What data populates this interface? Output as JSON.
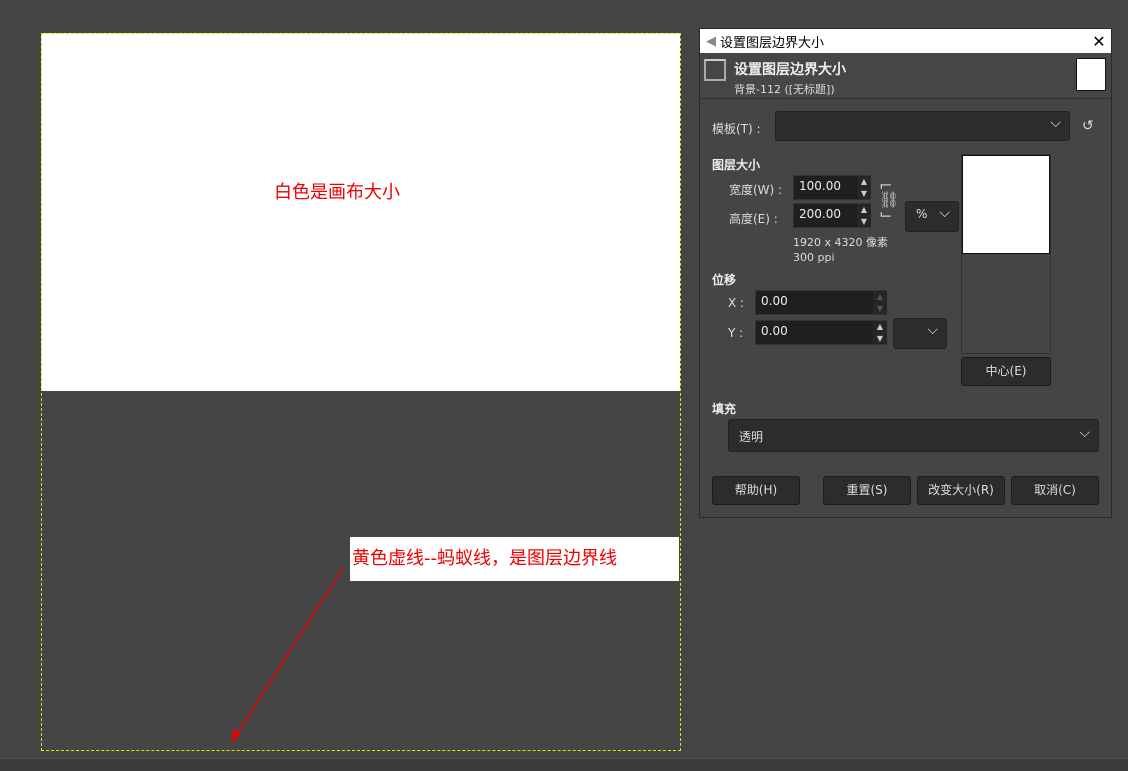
{
  "canvas": {
    "annotation_canvas": "白色是画布大小",
    "annotation_border": "黄色虚线--蚂蚁线，是图层边界线"
  },
  "dialog": {
    "window_title": "设置图层边界大小",
    "close_label": "✕",
    "header_title": "设置图层边界大小",
    "header_subtitle": "背景-112 ([无标题])",
    "template_label": "模板(T) :",
    "template_value": "",
    "layer_size_label": "图层大小",
    "width_label": "宽度(W) :",
    "width_value": "100.00",
    "height_label": "高度(E) :",
    "height_value": "200.00",
    "unit_value": "%",
    "pixel_size": "1920 x 4320 像素",
    "resolution": "300 ppi",
    "offset_label": "位移",
    "x_label": "X :",
    "x_value": "0.00",
    "y_label": "Y :",
    "y_value": "0.00",
    "offset_unit_value": "",
    "center_button": "中心(E)",
    "fill_label": "填充",
    "fill_value": "透明",
    "buttons": {
      "help": "帮助(H)",
      "reset": "重置(S)",
      "resize": "改变大小(R)",
      "cancel": "取消(C)"
    }
  }
}
